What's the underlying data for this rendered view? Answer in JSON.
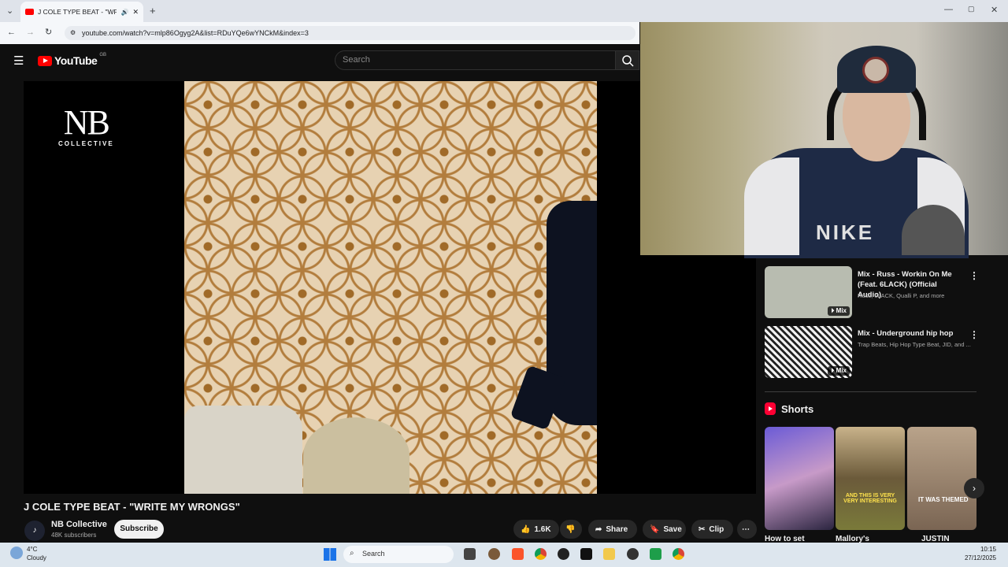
{
  "browser": {
    "tab_title": "J COLE TYPE BEAT - \"WRITE",
    "url": "youtube.com/watch?v=mlp86Ogyg2A&list=RDuYQe6wYNCkM&index=3",
    "new_tab": "+",
    "close_tab": "✕"
  },
  "youtube": {
    "logo_text": "YouTube",
    "region": "GB",
    "search_placeholder": "Search"
  },
  "video": {
    "overlay_logo_big": "NB",
    "overlay_logo_small": "COLLECTIVE",
    "title": "J COLE TYPE BEAT - \"WRITE MY WRONGS\"",
    "channel": "NB Collective",
    "subscribers": "48K subscribers",
    "subscribe_label": "Subscribe",
    "likes": "1.6K",
    "share_label": "Share",
    "save_label": "Save",
    "clip_label": "Clip"
  },
  "sidebar": {
    "mixes": [
      {
        "title": "Mix - Russ - Workin On Me (Feat. 6LACK) (Official Audio)",
        "subtitle": "Russ, 6LACK, Qualli P, and more",
        "badge": "Mix"
      },
      {
        "title": "Mix - Underground hip hop",
        "subtitle": "Trap Beats, Hip Hop Type Beat, JID, and ...",
        "badge": "Mix"
      }
    ],
    "shorts_heading": "Shorts",
    "shorts": [
      {
        "title": "How to set",
        "overlay": ""
      },
      {
        "title": "Mallory's",
        "overlay": "AND THIS IS VERY VERY INTERESTING"
      },
      {
        "title": "JUSTIN",
        "overlay": "IT WAS THEMED"
      }
    ]
  },
  "taskbar": {
    "temperature": "4°C",
    "condition": "Cloudy",
    "search_label": "Search",
    "time": "10:15",
    "date": "27/12/2025"
  },
  "colors": {
    "youtube_red": "#ff0000",
    "background": "#0f0f0f",
    "text": "#f1f1f1"
  }
}
